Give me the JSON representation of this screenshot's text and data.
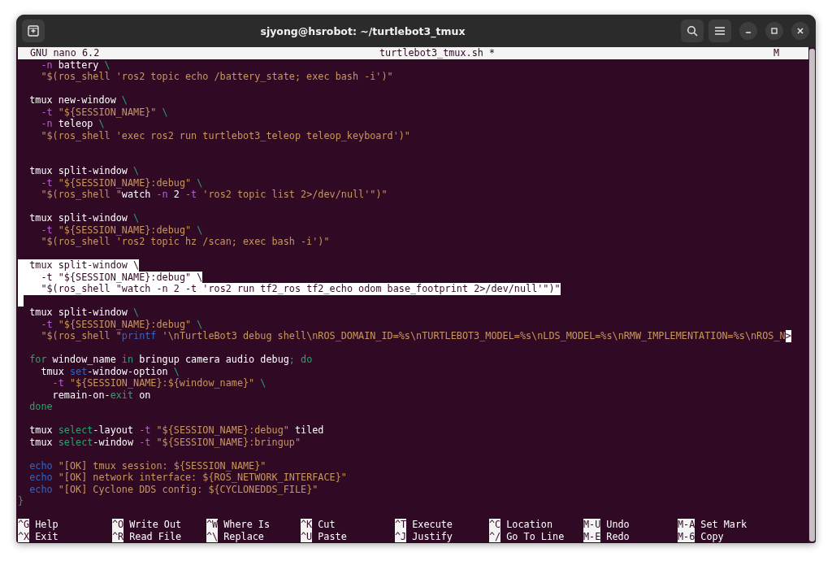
{
  "window": {
    "title": "sjyong@hsrobot: ~/turtlebot3_tmux"
  },
  "nano_header": {
    "version": "GNU nano 6.2",
    "filename": "turtlebot3_tmux.sh *",
    "modified": "M"
  },
  "lines": [
    {
      "selected": false,
      "segments": [
        {
          "text": "    -n",
          "kind": "flag"
        },
        {
          "text": " battery ",
          "kind": "plain"
        },
        {
          "text": "\\",
          "kind": "esc"
        }
      ]
    },
    {
      "selected": false,
      "segments": [
        {
          "text": "    \"$(ros_shell 'ros2 topic echo /battery_state; exec bash -i')\"",
          "kind": "str"
        }
      ]
    },
    {
      "selected": false
    },
    {
      "selected": false,
      "segments": [
        {
          "text": "  tmux new-window ",
          "kind": "plain"
        },
        {
          "text": "\\",
          "kind": "esc"
        }
      ]
    },
    {
      "selected": false,
      "segments": [
        {
          "text": "    -t",
          "kind": "flag"
        },
        {
          "text": " \"${SESSION_NAME}\"",
          "kind": "str"
        },
        {
          "text": " \\",
          "kind": "esc"
        }
      ]
    },
    {
      "selected": false,
      "segments": [
        {
          "text": "    -n",
          "kind": "flag"
        },
        {
          "text": " teleop ",
          "kind": "plain"
        },
        {
          "text": "\\",
          "kind": "esc"
        }
      ]
    },
    {
      "selected": false,
      "segments": [
        {
          "text": "    \"$(ros_shell 'exec ros2 run turtlebot3_teleop teleop_keyboard')\"",
          "kind": "str"
        }
      ]
    },
    {
      "selected": false
    },
    {
      "selected": false
    },
    {
      "selected": false,
      "segments": [
        {
          "text": "  tmux split-window ",
          "kind": "plain"
        },
        {
          "text": "\\",
          "kind": "esc"
        }
      ]
    },
    {
      "selected": false,
      "segments": [
        {
          "text": "    -t",
          "kind": "flag"
        },
        {
          "text": " \"${SESSION_NAME}:debug\"",
          "kind": "str"
        },
        {
          "text": " \\",
          "kind": "esc"
        }
      ]
    },
    {
      "selected": false,
      "segments": [
        {
          "text": "    \"$(ros_shell \"",
          "kind": "str"
        },
        {
          "text": "watch ",
          "kind": "plain"
        },
        {
          "text": "-n",
          "kind": "flag"
        },
        {
          "text": " 2 ",
          "kind": "plain"
        },
        {
          "text": "-t",
          "kind": "flag"
        },
        {
          "text": " 'ros2 topic list 2>/dev/null'\")\"",
          "kind": "str"
        }
      ]
    },
    {
      "selected": false
    },
    {
      "selected": false,
      "segments": [
        {
          "text": "  tmux split-window ",
          "kind": "plain"
        },
        {
          "text": "\\",
          "kind": "esc"
        }
      ]
    },
    {
      "selected": false,
      "segments": [
        {
          "text": "    -t",
          "kind": "flag"
        },
        {
          "text": " \"${SESSION_NAME}:debug\"",
          "kind": "str"
        },
        {
          "text": " \\",
          "kind": "esc"
        }
      ]
    },
    {
      "selected": false,
      "segments": [
        {
          "text": "    \"$(ros_shell 'ros2 topic hz /scan; exec bash -i')\"",
          "kind": "str"
        }
      ]
    },
    {
      "selected": false
    },
    {
      "selected": true,
      "segments": [
        {
          "text": "  tmux split-window ",
          "kind": "plain"
        },
        {
          "text": "\\",
          "kind": "esc"
        }
      ]
    },
    {
      "selected": true,
      "segments": [
        {
          "text": "    -t",
          "kind": "flag"
        },
        {
          "text": " \"${SESSION_NAME}:debug\"",
          "kind": "str"
        },
        {
          "text": " \\",
          "kind": "esc"
        }
      ]
    },
    {
      "selected": true,
      "segments": [
        {
          "text": "    \"$(ros_shell \"",
          "kind": "str"
        },
        {
          "text": "watch ",
          "kind": "plain"
        },
        {
          "text": "-n",
          "kind": "flag"
        },
        {
          "text": " 2 ",
          "kind": "plain"
        },
        {
          "text": "-t",
          "kind": "flag"
        },
        {
          "text": " 'ros2 run tf2_ros tf2_echo odom base_footprint 2>/dev/null'\")\"",
          "kind": "str"
        }
      ]
    },
    {
      "selected": true
    },
    {
      "selected": false,
      "segments": [
        {
          "text": "  tmux split-window ",
          "kind": "plain"
        },
        {
          "text": "\\",
          "kind": "esc"
        }
      ]
    },
    {
      "selected": false,
      "segments": [
        {
          "text": "    -t",
          "kind": "flag"
        },
        {
          "text": " \"${SESSION_NAME}:debug\"",
          "kind": "str"
        },
        {
          "text": " \\",
          "kind": "esc"
        }
      ]
    },
    {
      "selected": false,
      "segments": [
        {
          "text": "    \"$(ros_shell \"",
          "kind": "str"
        },
        {
          "text": "printf",
          "kind": "cmd"
        },
        {
          "text": " '\\nTurtleBot3 debug shell\\nROS_DOMAIN_ID=%s\\nTURTLEBOT3_MODEL=%s\\nLDS_MODEL=%s\\nRMW_IMPLEMENTATION=%s\\nROS_N",
          "kind": "str"
        }
      ],
      "more": ">"
    },
    {
      "selected": false
    },
    {
      "selected": false,
      "segments": [
        {
          "text": "  for",
          "kind": "kw"
        },
        {
          "text": " window_name ",
          "kind": "plain"
        },
        {
          "text": "in",
          "kind": "kw"
        },
        {
          "text": " bringup camera audio debug",
          "kind": "plain"
        },
        {
          "text": "; do",
          "kind": "kw"
        }
      ]
    },
    {
      "selected": false,
      "segments": [
        {
          "text": "    tmux ",
          "kind": "plain"
        },
        {
          "text": "set",
          "kind": "cmd"
        },
        {
          "text": "-window-option ",
          "kind": "plain"
        },
        {
          "text": "\\",
          "kind": "esc"
        }
      ]
    },
    {
      "selected": false,
      "segments": [
        {
          "text": "      -t",
          "kind": "flag"
        },
        {
          "text": " \"${SESSION_NAME}:${window_name}\"",
          "kind": "str"
        },
        {
          "text": " \\",
          "kind": "esc"
        }
      ]
    },
    {
      "selected": false,
      "segments": [
        {
          "text": "      remain-on-",
          "kind": "plain"
        },
        {
          "text": "exit",
          "kind": "kw"
        },
        {
          "text": " on",
          "kind": "plain"
        }
      ]
    },
    {
      "selected": false,
      "segments": [
        {
          "text": "  done",
          "kind": "kw"
        }
      ]
    },
    {
      "selected": false
    },
    {
      "selected": false,
      "segments": [
        {
          "text": "  tmux ",
          "kind": "plain"
        },
        {
          "text": "select",
          "kind": "kw"
        },
        {
          "text": "-layout ",
          "kind": "plain"
        },
        {
          "text": "-t",
          "kind": "flag"
        },
        {
          "text": " \"${SESSION_NAME}:debug\"",
          "kind": "str"
        },
        {
          "text": " tiled",
          "kind": "plain"
        }
      ]
    },
    {
      "selected": false,
      "segments": [
        {
          "text": "  tmux ",
          "kind": "plain"
        },
        {
          "text": "select",
          "kind": "kw"
        },
        {
          "text": "-window ",
          "kind": "plain"
        },
        {
          "text": "-t",
          "kind": "flag"
        },
        {
          "text": " \"${SESSION_NAME}:bringup\"",
          "kind": "str"
        }
      ]
    },
    {
      "selected": false
    },
    {
      "selected": false,
      "segments": [
        {
          "text": "  echo",
          "kind": "cmd"
        },
        {
          "text": " \"[OK] tmux session: ${SESSION_NAME}\"",
          "kind": "str"
        }
      ]
    },
    {
      "selected": false,
      "segments": [
        {
          "text": "  echo",
          "kind": "cmd"
        },
        {
          "text": " \"[OK] network interface: ${ROS_NETWORK_INTERFACE}\"",
          "kind": "str"
        }
      ]
    },
    {
      "selected": false,
      "segments": [
        {
          "text": "  echo",
          "kind": "cmd"
        },
        {
          "text": " \"[OK] Cyclone DDS config: ${CYCLONEDDS_FILE}\"",
          "kind": "str"
        }
      ]
    },
    {
      "selected": false,
      "segments": [
        {
          "text": "}",
          "kind": "kw"
        }
      ]
    }
  ],
  "shortcuts": [
    {
      "key": "^G",
      "label": "Help"
    },
    {
      "key": "^O",
      "label": "Write Out"
    },
    {
      "key": "^W",
      "label": "Where Is"
    },
    {
      "key": "^K",
      "label": "Cut"
    },
    {
      "key": "^T",
      "label": "Execute"
    },
    {
      "key": "^C",
      "label": "Location"
    },
    {
      "key": "M-U",
      "label": "Undo"
    },
    {
      "key": "M-A",
      "label": "Set Mark"
    },
    {
      "key": "^X",
      "label": "Exit"
    },
    {
      "key": "^R",
      "label": "Read File"
    },
    {
      "key": "^\\",
      "label": "Replace"
    },
    {
      "key": "^U",
      "label": "Paste"
    },
    {
      "key": "^J",
      "label": "Justify"
    },
    {
      "key": "^/",
      "label": "Go To Line"
    },
    {
      "key": "M-E",
      "label": "Redo"
    },
    {
      "key": "M-6",
      "label": "Copy"
    }
  ]
}
